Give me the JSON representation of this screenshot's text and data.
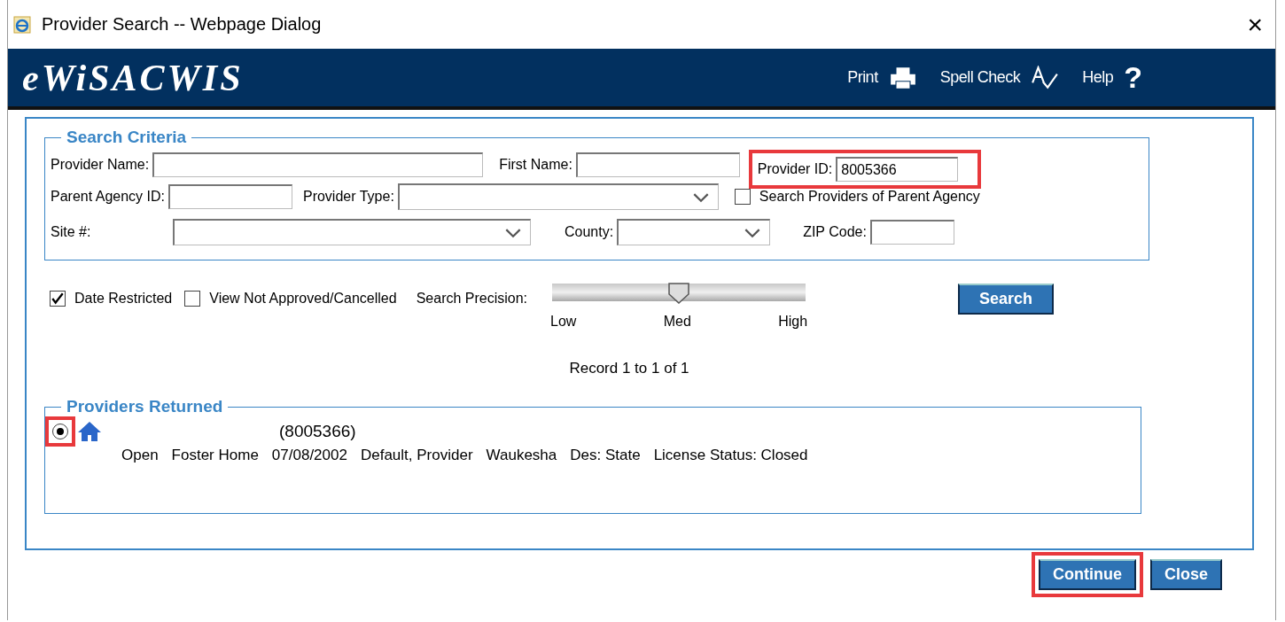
{
  "window": {
    "title": "Provider Search -- Webpage Dialog",
    "close": "×"
  },
  "banner": {
    "logo": "eWiSACWIS",
    "actions": [
      {
        "kind": "print",
        "label": "Print"
      },
      {
        "kind": "spell",
        "label": "Spell Check"
      },
      {
        "kind": "help",
        "label": "Help",
        "glyph": "?"
      }
    ]
  },
  "search_criteria": {
    "legend": "Search Criteria",
    "provider_name": {
      "label": "Provider Name:"
    },
    "first_name": {
      "label": "First Name:"
    },
    "provider_id": {
      "label": "Provider ID:",
      "value": "8005366",
      "highlighted": true
    },
    "parent_agency_id": {
      "label": "Parent Agency ID:"
    },
    "provider_type": {
      "label": "Provider Type:"
    },
    "search_parent_agency": {
      "label": "Search Providers of Parent Agency",
      "checked": false
    },
    "site": {
      "label": "Site #:"
    },
    "county": {
      "label": "County:"
    },
    "zip_code": {
      "label": "ZIP Code:"
    }
  },
  "options": [
    {
      "label": "Date Restricted",
      "checked": true
    },
    {
      "label": "View Not Approved/Cancelled",
      "checked": false
    }
  ],
  "precision": {
    "label": "Search Precision:",
    "level": 0.5,
    "ticks": [
      "Low",
      "Med",
      "High"
    ]
  },
  "search_button": "Search",
  "record_count": "Record 1 to 1 of 1",
  "providers_returned": {
    "legend": "Providers Returned",
    "rows": [
      {
        "selected": true,
        "highlighted": true,
        "id": "(8005366)",
        "details": [
          "Open",
          "Foster Home",
          "07/08/2002",
          "Default, Provider",
          "Waukesha",
          "Des: State",
          "License Status: Closed"
        ]
      }
    ]
  },
  "buttons": [
    {
      "label": "Continue",
      "highlighted": true
    },
    {
      "label": "Close",
      "highlighted": false
    }
  ]
}
